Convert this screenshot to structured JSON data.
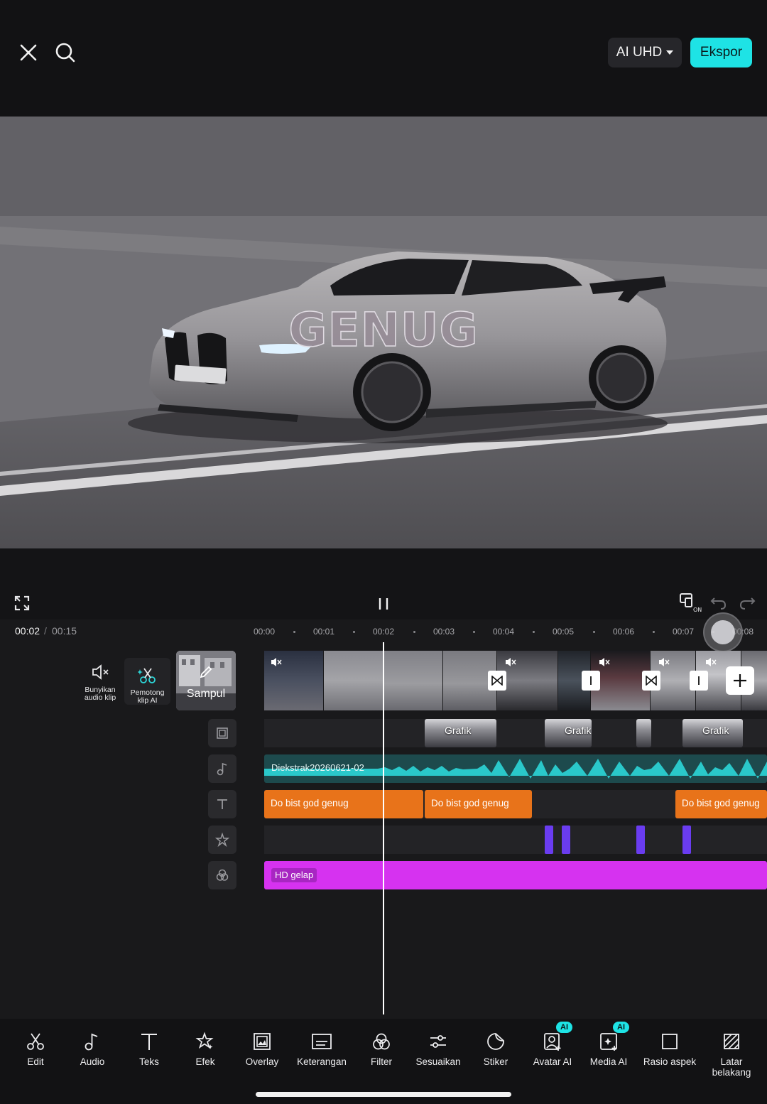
{
  "header": {
    "quality_label": "AI UHD",
    "export_label": "Ekspor"
  },
  "preview": {
    "overlay_text": "GENUG"
  },
  "playback": {
    "current_time": "00:02",
    "separator": "/",
    "total_time": "00:15"
  },
  "ruler": [
    "00:00",
    "00:01",
    "00:02",
    "00:03",
    "00:04",
    "00:05",
    "00:06",
    "00:07",
    "00:08"
  ],
  "side_tools": {
    "mute_label": "Bunyikan audio klip",
    "ai_cutter_label": "Pemotong klip AI",
    "cover_label": "Sampul"
  },
  "tracks": {
    "overlay_clips": [
      "Grafik",
      "Grafik",
      "Grafik"
    ],
    "audio_clip": "Diekstrak20260621-02",
    "text_clips": [
      "Do bist god genug",
      "Do bist god genug",
      "Do bist god genug"
    ],
    "filter_clip": "HD gelap"
  },
  "toolbar": {
    "items": [
      {
        "label": "Edit",
        "icon": "scissors-icon"
      },
      {
        "label": "Audio",
        "icon": "music-note-icon"
      },
      {
        "label": "Teks",
        "icon": "text-icon"
      },
      {
        "label": "Efek",
        "icon": "effects-star-icon"
      },
      {
        "label": "Overlay",
        "icon": "overlay-icon"
      },
      {
        "label": "Keterangan",
        "icon": "captions-icon"
      },
      {
        "label": "Filter",
        "icon": "filter-icon"
      },
      {
        "label": "Sesuaikan",
        "icon": "adjust-sliders-icon"
      },
      {
        "label": "Stiker",
        "icon": "sticker-icon"
      },
      {
        "label": "Avatar AI",
        "icon": "avatar-icon"
      },
      {
        "label": "Media AI",
        "icon": "ai-media-icon"
      },
      {
        "label": "Rasio aspek",
        "icon": "aspect-ratio-icon"
      },
      {
        "label": "Latar belakang",
        "icon": "background-icon"
      }
    ],
    "ai_badge": "AI"
  },
  "colors": {
    "accent": "#1ee3e5",
    "text_clip": "#e8731a",
    "filter_clip": "#d632f0",
    "effect_marker": "#6a3cf0",
    "audio_wave": "#2cd6d8"
  }
}
